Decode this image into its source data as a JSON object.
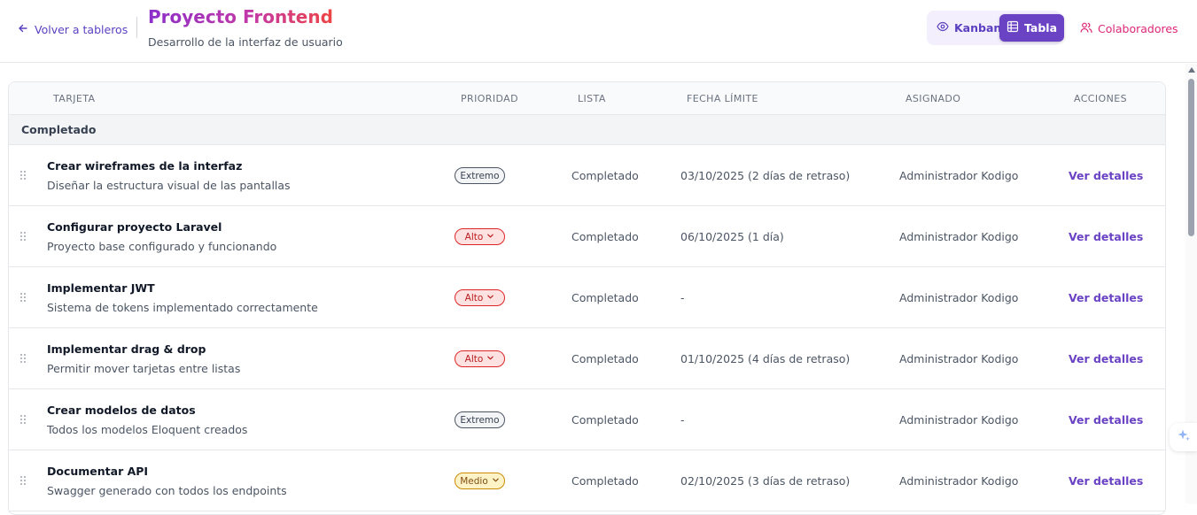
{
  "header": {
    "back_label": "Volver a tableros",
    "title": "Proyecto Frontend",
    "subtitle": "Desarrollo de la interfaz de usuario",
    "view_kanban": "Kanban",
    "view_tabla": "Tabla",
    "active_view": "Tabla",
    "collaborators_label": "Colaboradores"
  },
  "table": {
    "columns": [
      "TARJETA",
      "PRIORIDAD",
      "LISTA",
      "FECHA LÍMITE",
      "ASIGNADO",
      "ACCIONES"
    ],
    "group_label": "Completado",
    "rows": [
      {
        "title": "Crear wireframes de la interfaz",
        "description": "Diseñar la estructura visual de las pantallas",
        "priority": "Extremo",
        "list": "Completado",
        "due": "03/10/2025 (2 días de retraso)",
        "assignee": "Administrador Kodigo",
        "action": "Ver detalles"
      },
      {
        "title": "Configurar proyecto Laravel",
        "description": "Proyecto base configurado y funcionando",
        "priority": "Alto",
        "list": "Completado",
        "due": "06/10/2025 (1 día)",
        "assignee": "Administrador Kodigo",
        "action": "Ver detalles"
      },
      {
        "title": "Implementar JWT",
        "description": "Sistema de tokens implementado correctamente",
        "priority": "Alto",
        "list": "Completado",
        "due": "-",
        "assignee": "Administrador Kodigo",
        "action": "Ver detalles"
      },
      {
        "title": "Implementar drag & drop",
        "description": "Permitir mover tarjetas entre listas",
        "priority": "Alto",
        "list": "Completado",
        "due": "01/10/2025 (4 días de retraso)",
        "assignee": "Administrador Kodigo",
        "action": "Ver detalles"
      },
      {
        "title": "Crear modelos de datos",
        "description": "Todos los modelos Eloquent creados",
        "priority": "Extremo",
        "list": "Completado",
        "due": "-",
        "assignee": "Administrador Kodigo",
        "action": "Ver detalles"
      },
      {
        "title": "Documentar API",
        "description": "Swagger generado con todos los endpoints",
        "priority": "Medio",
        "list": "Completado",
        "due": "02/10/2025 (3 días de retraso)",
        "assignee": "Administrador Kodigo",
        "action": "Ver detalles"
      }
    ]
  },
  "colors": {
    "accent": "#6a42c4",
    "collaborators": "#db2777",
    "priority_extremo": "#4b5563",
    "priority_alto": "#dc2626",
    "priority_medio": "#ca8a04"
  },
  "icons": {
    "back": "arrow-left-icon",
    "kanban": "eye-icon",
    "tabla": "table-grid-icon",
    "collaborators": "users-icon",
    "drag": "drag-handle-icon",
    "priority_dropdown": "chevron-down-icon",
    "assistant": "sparkle-icon"
  }
}
